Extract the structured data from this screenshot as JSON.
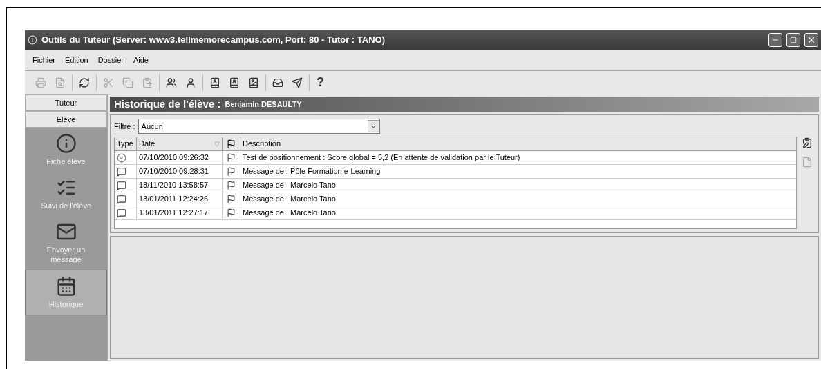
{
  "window": {
    "title": "Outils du Tuteur (Server: www3.tellmemorecampus.com, Port: 80 - Tutor : TANO)"
  },
  "menu": [
    "Fichier",
    "Edition",
    "Dossier",
    "Aide"
  ],
  "toolbar": [
    [
      {
        "kind": "print",
        "disabled": true
      },
      {
        "kind": "preview",
        "disabled": true
      }
    ],
    [
      {
        "kind": "refresh",
        "disabled": false
      }
    ],
    [
      {
        "kind": "cut",
        "disabled": true
      },
      {
        "kind": "copy",
        "disabled": true
      },
      {
        "kind": "paste",
        "disabled": true
      }
    ],
    [
      {
        "kind": "users",
        "disabled": false
      },
      {
        "kind": "user",
        "disabled": false
      }
    ],
    [
      {
        "kind": "book",
        "disabled": false
      },
      {
        "kind": "book",
        "disabled": false
      },
      {
        "kind": "picture-book",
        "disabled": false
      }
    ],
    [
      {
        "kind": "inbox",
        "disabled": false
      },
      {
        "kind": "send",
        "disabled": false
      }
    ],
    [
      {
        "kind": "help",
        "label": "?",
        "disabled": false
      }
    ]
  ],
  "sidebar": {
    "tabs": [
      "Tuteur",
      "Elève"
    ],
    "items": [
      {
        "kind": "info",
        "label": "Fiche élève",
        "selected": false
      },
      {
        "kind": "list",
        "label": "Suivi de l'élève",
        "selected": false
      },
      {
        "kind": "mail",
        "label": "Envoyer un message",
        "selected": false
      },
      {
        "kind": "calendar",
        "label": "Historique",
        "selected": true
      }
    ]
  },
  "panel": {
    "title": "Historique de l'élève :",
    "student": "Benjamin DESAULTY",
    "filter": {
      "label": "Filtre :",
      "value": "Aucun"
    },
    "table": {
      "columns": [
        "Type",
        "Date",
        "",
        "Description"
      ],
      "rows": [
        {
          "kind": "test",
          "date": "07/10/2010 09:26:32",
          "description": "Test de positionnement : Score global = 5,2 (En attente de validation par le Tuteur)"
        },
        {
          "kind": "message",
          "date": "07/10/2010 09:28:31",
          "description": "Message de : Pôle Formation e-Learning"
        },
        {
          "kind": "message",
          "date": "18/11/2010 13:58:57",
          "description": "Message de : Marcelo Tano"
        },
        {
          "kind": "message",
          "date": "13/01/2011 12:24:26",
          "description": "Message de : Marcelo Tano"
        },
        {
          "kind": "message",
          "date": "13/01/2011 12:27:17",
          "description": "Message de : Marcelo Tano"
        }
      ]
    },
    "side_tools": [
      {
        "kind": "edit",
        "disabled": false
      },
      {
        "kind": "file",
        "disabled": true
      }
    ]
  }
}
